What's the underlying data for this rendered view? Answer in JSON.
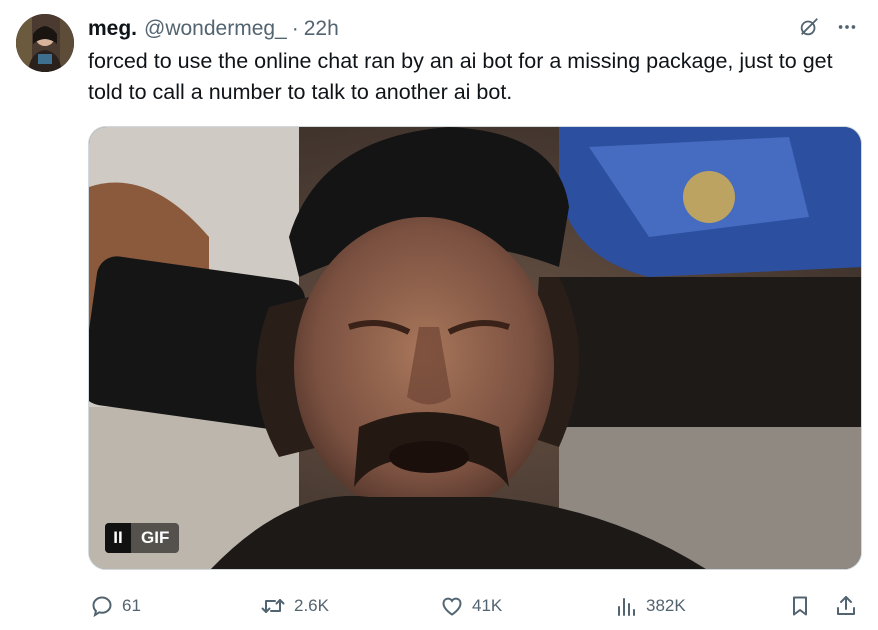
{
  "tweet": {
    "display_name": "meg.",
    "handle": "@wondermeg_",
    "separator": "·",
    "time": "22h",
    "text": "forced to use the online chat ran by an ai bot for a missing package, just to get told to call a number to talk to another ai bot."
  },
  "media": {
    "gif_label": "GIF",
    "pause_glyph": "II"
  },
  "actions": {
    "replies": "61",
    "reposts": "2.6K",
    "likes": "41K",
    "views": "382K"
  },
  "colors": {
    "text": "#0f1419",
    "secondary": "#536471",
    "border": "#cfd9de"
  }
}
